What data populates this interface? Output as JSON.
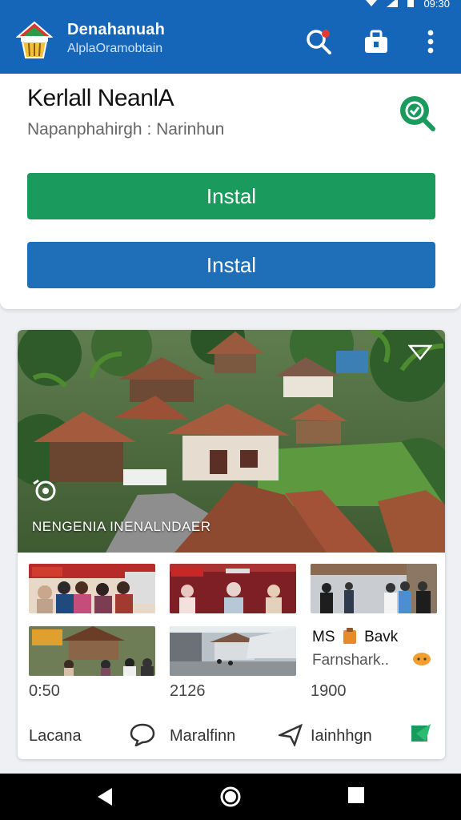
{
  "status": {
    "time": "09:30"
  },
  "appbar": {
    "title": "Denahanuah",
    "subtitle": "AlplaOramobtain",
    "actions": [
      "search-icon",
      "bag-icon",
      "more-vert-icon"
    ]
  },
  "app": {
    "name": "Kerlall NeanlA",
    "developer": "Napanphahirgh : Narinhun",
    "install_primary": "Instal",
    "install_secondary": "Instal"
  },
  "feature": {
    "hero_text": "NENGENIA INENALNDAER",
    "thumbnails": [
      {
        "badge": ""
      },
      {
        "badge": ""
      },
      {
        "badge": ""
      },
      {
        "badge": ""
      },
      {
        "badge": ""
      }
    ],
    "side_title": "MS",
    "side_title_2": "Bavk",
    "side_sub": "Farnshark..",
    "numbers": [
      "0:50",
      "2126",
      "1900"
    ],
    "footer": [
      "Lacana",
      "Maralfinn",
      "Iainhhgn"
    ]
  },
  "colors": {
    "primary": "#1565b8",
    "green": "#1b9a5e",
    "blue": "#1e6fb8"
  }
}
